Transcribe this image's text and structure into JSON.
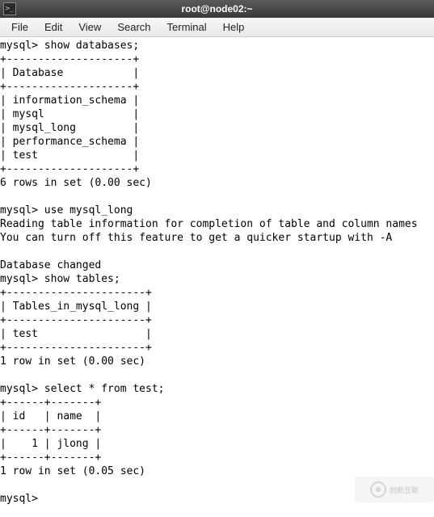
{
  "titlebar": {
    "title": "root@node02:~"
  },
  "menubar": {
    "items": [
      "File",
      "Edit",
      "View",
      "Search",
      "Terminal",
      "Help"
    ]
  },
  "terminal": {
    "lines": [
      "mysql> show databases;",
      "+--------------------+",
      "| Database           |",
      "+--------------------+",
      "| information_schema |",
      "| mysql              |",
      "| mysql_long         |",
      "| performance_schema |",
      "| test               |",
      "+--------------------+",
      "6 rows in set (0.00 sec)",
      "",
      "mysql> use mysql_long",
      "Reading table information for completion of table and column names",
      "You can turn off this feature to get a quicker startup with -A",
      "",
      "Database changed",
      "mysql> show tables;",
      "+----------------------+",
      "| Tables_in_mysql_long |",
      "+----------------------+",
      "| test                 |",
      "+----------------------+",
      "1 row in set (0.00 sec)",
      "",
      "mysql> select * from test;",
      "+------+-------+",
      "| id   | name  |",
      "+------+-------+",
      "|    1 | jlong |",
      "+------+-------+",
      "1 row in set (0.05 sec)",
      "",
      "mysql> "
    ]
  },
  "watermark": {
    "text": "创新互联"
  },
  "chart_data": {
    "type": "table",
    "databases_query": {
      "command": "show databases;",
      "column": "Database",
      "rows": [
        "information_schema",
        "mysql",
        "mysql_long",
        "performance_schema",
        "test"
      ],
      "row_count": 6,
      "time_sec": 0.0
    },
    "use_command": {
      "command": "use mysql_long",
      "messages": [
        "Reading table information for completion of table and column names",
        "You can turn off this feature to get a quicker startup with -A",
        "Database changed"
      ]
    },
    "tables_query": {
      "command": "show tables;",
      "column": "Tables_in_mysql_long",
      "rows": [
        "test"
      ],
      "row_count": 1,
      "time_sec": 0.0
    },
    "select_query": {
      "command": "select * from test;",
      "columns": [
        "id",
        "name"
      ],
      "rows": [
        {
          "id": 1,
          "name": "jlong"
        }
      ],
      "row_count": 1,
      "time_sec": 0.05
    }
  }
}
